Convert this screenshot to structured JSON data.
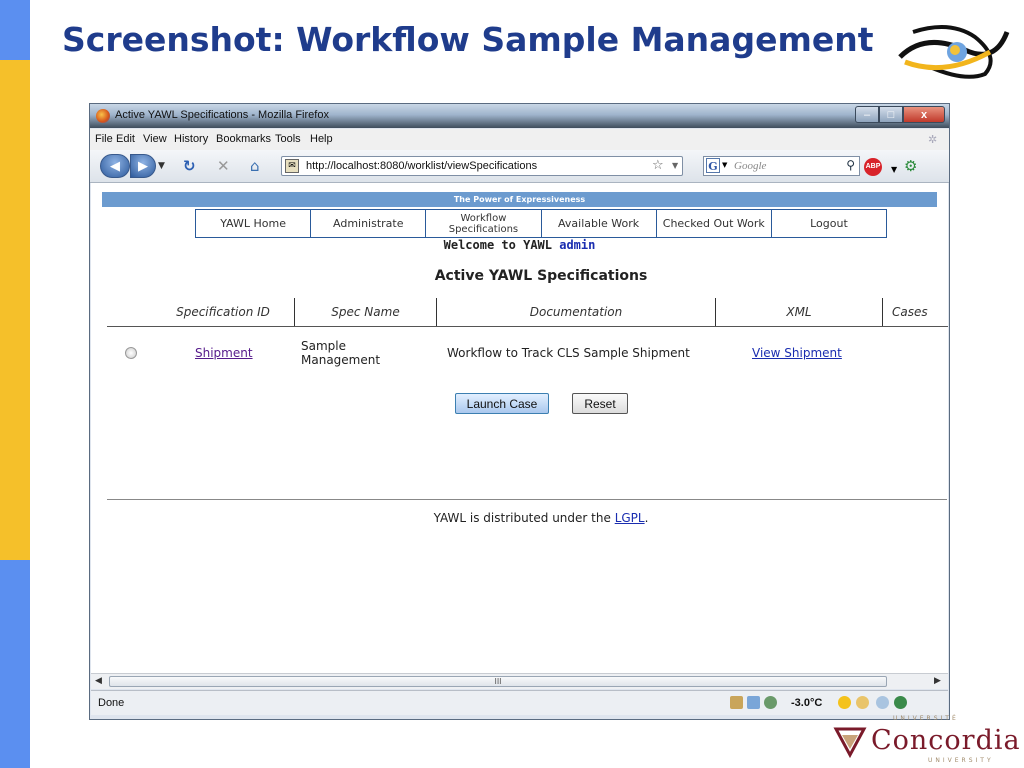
{
  "slide": {
    "title": "Screenshot: Workflow Sample Management",
    "concordia_top": "UNIVERSITÉ",
    "concordia_word": "Concordia",
    "concordia_bottom": "UNIVERSITY"
  },
  "browser": {
    "window_title": "Active YAWL Specifications - Mozilla Firefox",
    "window_buttons": {
      "minimize": "–",
      "maximize": "□",
      "close": "x"
    },
    "menu": [
      "File",
      "Edit",
      "View",
      "History",
      "Bookmarks",
      "Tools",
      "Help"
    ],
    "url": "http://localhost:8080/worklist/viewSpecifications",
    "search_placeholder": "Google",
    "addon_label": "ABP",
    "status_text": "Done",
    "temperature": "-3.0°C",
    "scroll_grip": "III"
  },
  "page": {
    "banner": "The Power of Expressiveness",
    "nav": [
      "YAWL Home",
      "Administrate",
      "Workflow Specifications",
      "Available Work",
      "Checked Out Work",
      "Logout"
    ],
    "welcome_prefix": "Welcome to YAWL",
    "welcome_user": "admin",
    "heading": "Active YAWL Specifications",
    "table": {
      "headers": [
        "Specification ID",
        "Spec Name",
        "Documentation",
        "XML",
        "Cases"
      ],
      "rows": [
        {
          "id": "Shipment",
          "name": "Sample Management",
          "documentation": "Workflow to Track CLS Sample Shipment",
          "xml": "View Shipment"
        }
      ]
    },
    "buttons": {
      "launch": "Launch Case",
      "reset": "Reset"
    },
    "footer_prefix": "YAWL is distributed under the",
    "footer_link": "LGPL",
    "footer_suffix": "."
  },
  "colors": {
    "title_blue": "#1f3c8c",
    "banner": "#6c9bcf",
    "link_visited": "#551a8b",
    "link": "#1a2db0",
    "concordia": "#7a1a2a"
  }
}
